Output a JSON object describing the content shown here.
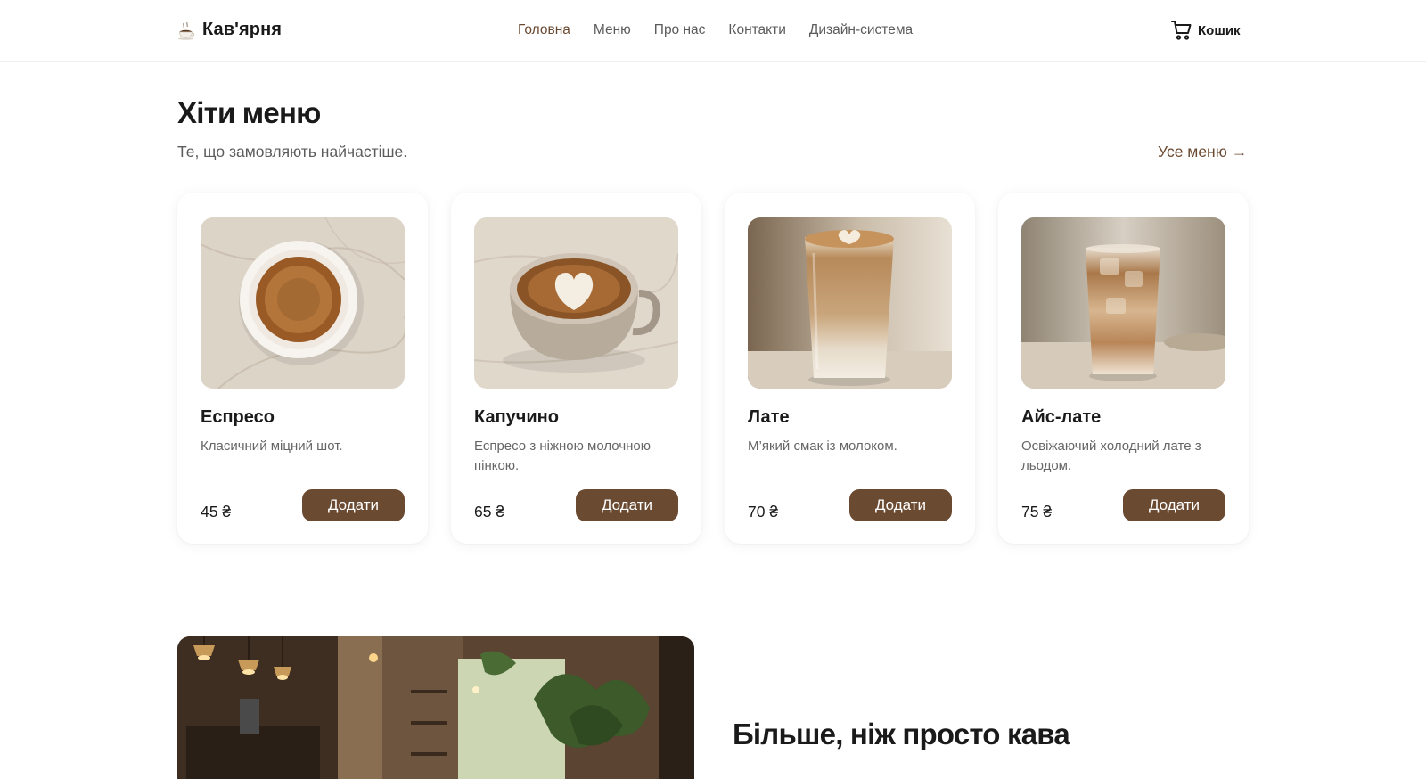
{
  "brand": {
    "name": "Кав'ярня",
    "icon": "coffee-cup-icon"
  },
  "nav": {
    "items": [
      {
        "label": "Головна",
        "active": true
      },
      {
        "label": "Меню",
        "active": false
      },
      {
        "label": "Про нас",
        "active": false
      },
      {
        "label": "Контакти",
        "active": false
      },
      {
        "label": "Дизайн-система",
        "active": false
      }
    ]
  },
  "cart": {
    "label": "Кошик",
    "icon": "cart-icon"
  },
  "hits": {
    "title": "Хіти меню",
    "subtitle": "Те, що замовляють найчастіше.",
    "all_menu_link": "Усе меню →"
  },
  "products": [
    {
      "name": "Еспресо",
      "description": "Класичний міцний шот.",
      "price": "45 ₴",
      "button": "Додати",
      "image": "espresso-photo"
    },
    {
      "name": "Капучино",
      "description": "Еспресо з ніжною молочною пінкою.",
      "price": "65 ₴",
      "button": "Додати",
      "image": "cappuccino-photo"
    },
    {
      "name": "Лате",
      "description": "М’який смак із молоком.",
      "price": "70 ₴",
      "button": "Додати",
      "image": "latte-photo"
    },
    {
      "name": "Айс-лате",
      "description": "Освіжаючий холодний лате з льодом.",
      "price": "75 ₴",
      "button": "Додати",
      "image": "iced-latte-photo"
    }
  ],
  "about": {
    "title": "Більше, ніж просто кава",
    "image": "cafe-interior-photo"
  },
  "colors": {
    "accent": "#6b4a32",
    "text": "#1a1a1a",
    "muted": "#666666",
    "border": "#efefef"
  }
}
